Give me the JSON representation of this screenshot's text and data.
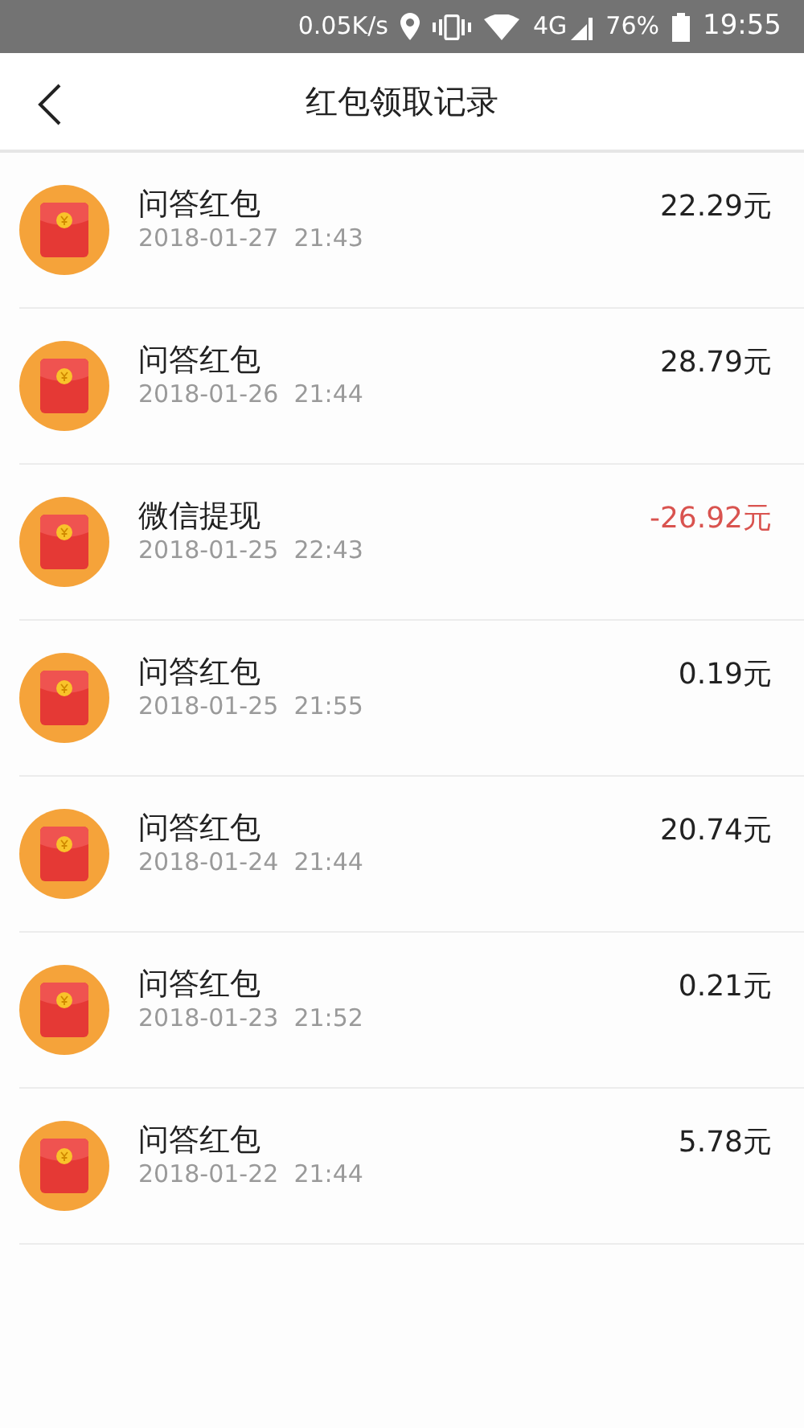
{
  "status_bar": {
    "speed": "0.05K/s",
    "network": "4G",
    "battery": "76%",
    "time": "19:55"
  },
  "header": {
    "title": "红包领取记录"
  },
  "records": [
    {
      "title": "问答红包",
      "datetime": "2018-01-27  21:43",
      "amount": "22.29元",
      "kind": "income"
    },
    {
      "title": "问答红包",
      "datetime": "2018-01-26  21:44",
      "amount": "28.79元",
      "kind": "income"
    },
    {
      "title": "微信提现",
      "datetime": "2018-01-25  22:43",
      "amount": "-26.92元",
      "kind": "withdrawal"
    },
    {
      "title": "问答红包",
      "datetime": "2018-01-25  21:55",
      "amount": "0.19元",
      "kind": "income"
    },
    {
      "title": "问答红包",
      "datetime": "2018-01-24  21:44",
      "amount": "20.74元",
      "kind": "income"
    },
    {
      "title": "问答红包",
      "datetime": "2018-01-23  21:52",
      "amount": "0.21元",
      "kind": "income"
    },
    {
      "title": "问答红包",
      "datetime": "2018-01-22  21:44",
      "amount": "5.78元",
      "kind": "income"
    }
  ]
}
